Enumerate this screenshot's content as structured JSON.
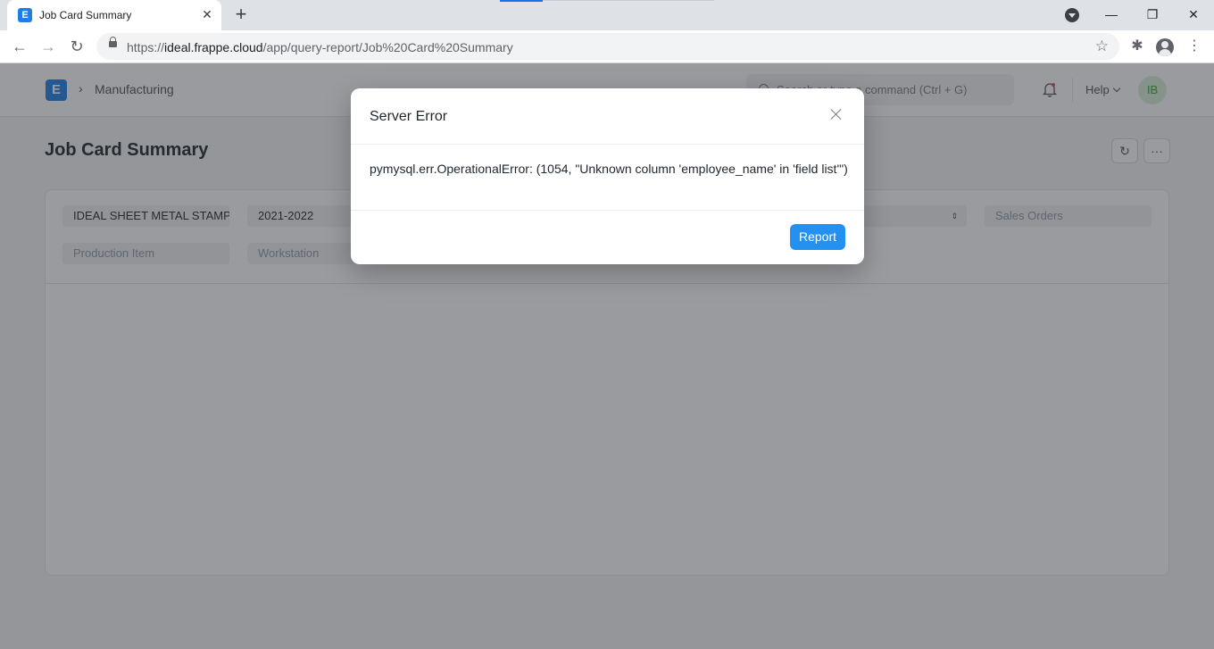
{
  "browser": {
    "tab_title": "Job Card Summary",
    "tab_favicon_letter": "E",
    "new_tab_glyph": "+",
    "close_glyph": "✕",
    "url_prefix": "https://",
    "url_host": "ideal.frappe.cloud",
    "url_path": "/app/query-report/Job%20Card%20Summary",
    "window_controls": {
      "minimize": "—",
      "restore": "❐",
      "close": "✕"
    },
    "nav": {
      "back": "←",
      "forward": "→",
      "reload": "↻",
      "star": "☆",
      "extensions": "✱",
      "menu": "⋮"
    }
  },
  "app": {
    "logo_letter": "E",
    "breadcrumb_sep": "›",
    "breadcrumb": "Manufacturing",
    "search_placeholder": "Search or type a command (Ctrl + G)",
    "help_label": "Help",
    "user_initials": "IB",
    "page_title": "Job Card Summary",
    "refresh_glyph": "↻",
    "more_glyph": "···",
    "filters": {
      "company": "IDEAL SHEET METAL STAMPING",
      "fiscal_year": "2021-2022",
      "status_updown": "⇕",
      "sales_orders": "Sales Orders",
      "production_item": "Production Item",
      "workstation": "Workstation"
    }
  },
  "modal": {
    "title": "Server Error",
    "message": "pymysql.err.OperationalError: (1054, \"Unknown column 'employee_name' in 'field list'\")",
    "button_label": "Report"
  },
  "colors": {
    "primary": "#2490ef",
    "brand": "#1d7fe4",
    "backdrop": "rgba(44,47,52,0.48)"
  }
}
